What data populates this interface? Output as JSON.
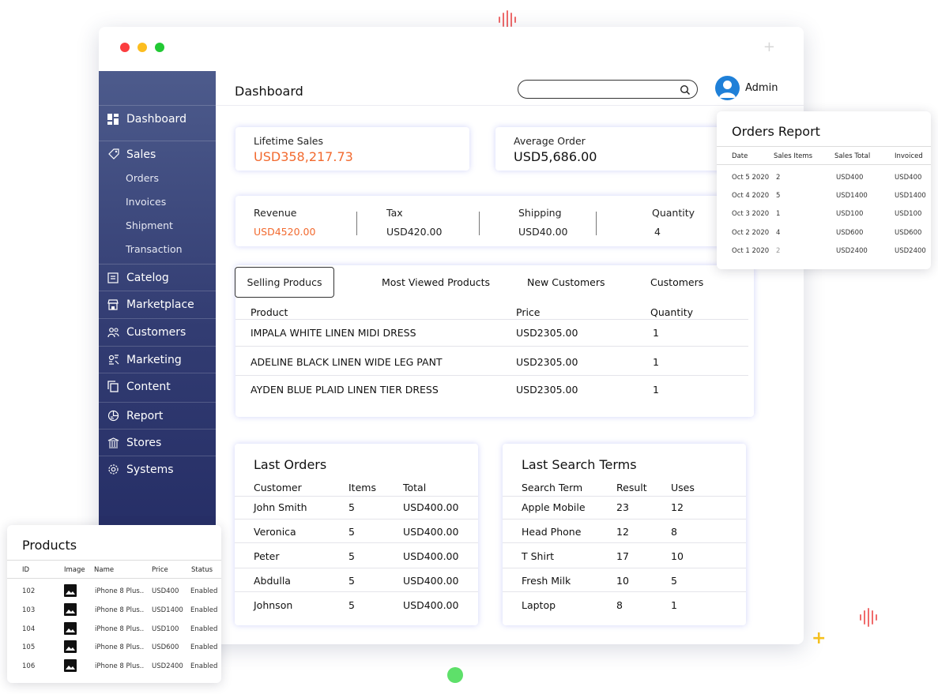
{
  "header": {
    "title": "Dashboard",
    "search_placeholder": "",
    "user_name": "Admin"
  },
  "sidebar": {
    "items": [
      {
        "label": "Dashboard",
        "icon": "dashboard-icon"
      },
      {
        "label": "Sales",
        "icon": "tag-icon"
      },
      {
        "label": "Catelog",
        "icon": "catalog-icon"
      },
      {
        "label": "Marketplace",
        "icon": "store-icon"
      },
      {
        "label": "Customers",
        "icon": "users-icon"
      },
      {
        "label": "Marketing",
        "icon": "marketing-icon"
      },
      {
        "label": "Content",
        "icon": "copy-icon"
      },
      {
        "label": "Report",
        "icon": "report-icon"
      },
      {
        "label": "Stores",
        "icon": "building-icon"
      },
      {
        "label": "Systems",
        "icon": "gear-icon"
      }
    ],
    "sales_sub": [
      "Orders",
      "Invoices",
      "Shipment",
      "Transaction"
    ]
  },
  "summary": {
    "lifetime_label": "Lifetime Sales",
    "lifetime_value": "USD358,217.73",
    "average_label": "Average Order",
    "average_value": "USD5,686.00"
  },
  "stats": [
    {
      "label": "Revenue",
      "value": "USD4520.00"
    },
    {
      "label": "Tax",
      "value": "USD420.00"
    },
    {
      "label": "Shipping",
      "value": "USD40.00"
    },
    {
      "label": "Quantity",
      "value": "4"
    }
  ],
  "tabs": [
    "Selling Producs",
    "Most Viewed Products",
    "New Customers",
    "Customers"
  ],
  "products_table": {
    "headers": [
      "Product",
      "Price",
      "Quantity"
    ],
    "rows": [
      [
        "IMPALA WHITE LINEN MIDI DRESS",
        "USD2305.00",
        "1"
      ],
      [
        "ADELINE BLACK LINEN WIDE LEG PANT",
        "USD2305.00",
        "1"
      ],
      [
        "AYDEN BLUE PLAID LINEN TIER DRESS",
        "USD2305.00",
        "1"
      ]
    ]
  },
  "last_orders": {
    "title": "Last Orders",
    "headers": [
      "Customer",
      "Items",
      "Total"
    ],
    "rows": [
      [
        "John Smith",
        "5",
        "USD400.00"
      ],
      [
        "Veronica",
        "5",
        "USD400.00"
      ],
      [
        "Peter",
        "5",
        "USD400.00"
      ],
      [
        "Abdulla",
        "5",
        "USD400.00"
      ],
      [
        "Johnson",
        "5",
        "USD400.00"
      ]
    ]
  },
  "last_search": {
    "title": "Last Search Terms",
    "headers": [
      "Search Term",
      "Result",
      "Uses"
    ],
    "rows": [
      [
        "Apple Mobile",
        "23",
        "12"
      ],
      [
        "Head Phone",
        "12",
        "8"
      ],
      [
        "T Shirt",
        "17",
        "10"
      ],
      [
        "Fresh Milk",
        "10",
        "5"
      ],
      [
        "Laptop",
        "8",
        "1"
      ]
    ]
  },
  "orders_report": {
    "title": "Orders Report",
    "headers": [
      "Date",
      "Sales Items",
      "Sales Total",
      "Invoiced"
    ],
    "rows": [
      [
        "Oct 5 2020",
        "2",
        "USD400",
        "USD400"
      ],
      [
        "Oct 4 2020",
        "5",
        "USD1400",
        "USD1400"
      ],
      [
        "Oct 3 2020",
        "1",
        "USD100",
        "USD100"
      ],
      [
        "Oct 2 2020",
        "4",
        "USD600",
        "USD600"
      ],
      [
        "Oct 1 2020",
        "2",
        "USD2400",
        "USD2400"
      ]
    ]
  },
  "products_panel": {
    "title": "Products",
    "headers": [
      "ID",
      "Image",
      "Name",
      "Price",
      "Status"
    ],
    "rows": [
      [
        "102",
        "iPhone 8 Plus..",
        "USD400",
        "Enabled"
      ],
      [
        "103",
        "iPhone 8 Plus..",
        "USD1400",
        "Enabled"
      ],
      [
        "104",
        "iPhone 8 Plus..",
        "USD100",
        "Enabled"
      ],
      [
        "105",
        "iPhone 8 Plus..",
        "USD600",
        "Enabled"
      ],
      [
        "106",
        "iPhone 8 Plus..",
        "USD2400",
        "Enabled"
      ]
    ]
  },
  "colors": {
    "accent_orange": "#f26a2f",
    "sidebar_top": "#4d5b8c",
    "sidebar_bottom": "#1f2760",
    "avatar_blue": "#1f80d8"
  },
  "decorations": [
    "plus-icon",
    "sound-wave-icon",
    "green-dot"
  ]
}
